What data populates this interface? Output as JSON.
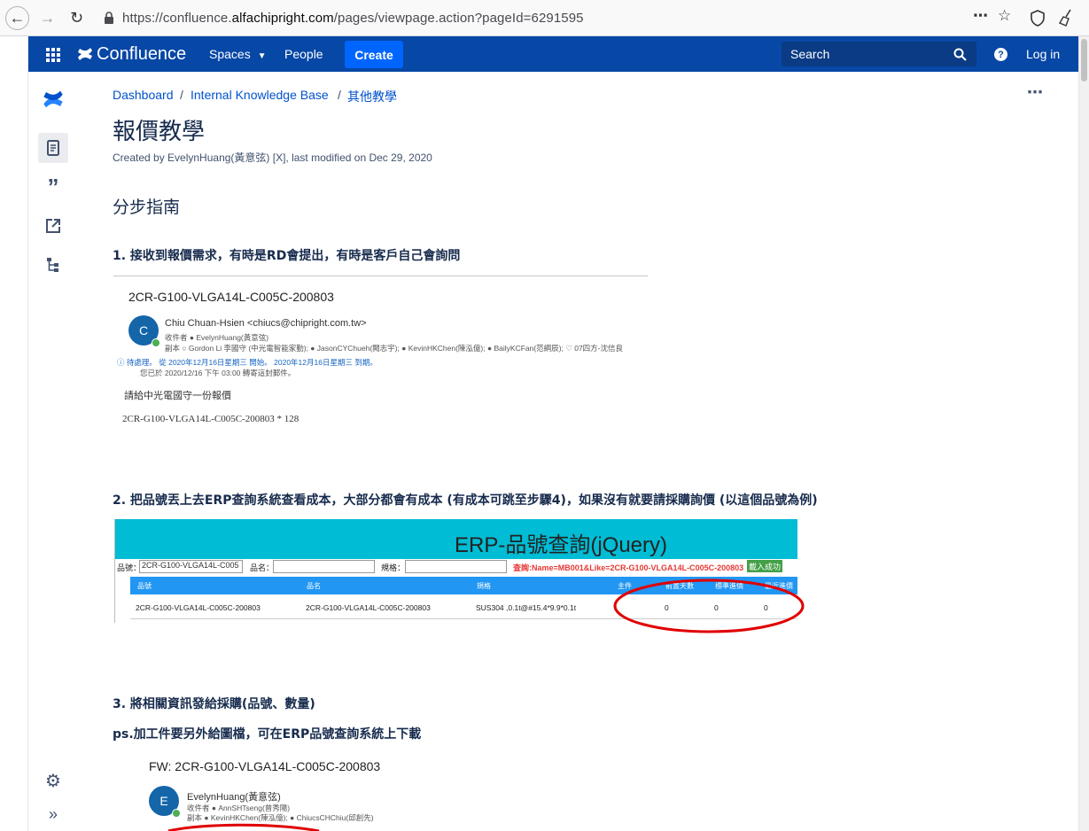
{
  "browser": {
    "url_prefix": "https://confluence.",
    "url_domain": "alfachipright.com",
    "url_suffix": "/pages/viewpage.action?pageId=6291595"
  },
  "header": {
    "logo_text": "Confluence",
    "spaces_label": "Spaces",
    "people_label": "People",
    "create_label": "Create",
    "search_placeholder": "Search",
    "login_label": "Log in"
  },
  "breadcrumbs": [
    "Dashboard",
    "Internal Knowledge Base",
    "其他教學"
  ],
  "page": {
    "title": "報價教學",
    "byline": "Created by EvelynHuang(黃意弦) [X], last modified on Dec 29, 2020",
    "section_heading": "分步指南",
    "step1": "1. 接收到報價需求，有時是RD會提出，有時是客戶自己會詢問",
    "step2": "2. 把品號丟上去ERP查詢系統查看成本，大部分都會有成本 (有成本可跳至步驟4)，如果沒有就要請採購詢價 (以這個品號為例)",
    "step3": "3. 將相關資訊發給採購(品號、數量)",
    "step3_note": "ps.加工件要另外給圖檔，可在ERP品號查詢系統上下載"
  },
  "email1": {
    "subject": "2CR-G100-VLGA14L-C005C-200803",
    "avatar_letter": "C",
    "from": "Chiu Chuan-Hsien <chiucs@chipright.com.tw>",
    "to": "收件者  ● EvelynHuang(黃意弦)",
    "cc": "副本  ○ Gordon Li 李國守 (中光電智能家勤); ● JasonCYChueh(闕志宇); ● KevinHKChen(陳泓億); ● BailyKCFan(范綱辰); ♡ 07四方-沈信良",
    "notice1": "待處理。 從 2020年12月16日星期三 開始。 2020年12月16日星期三 到期。",
    "notice2": "您已於 2020/12/16 下午 03:00 轉寄這封郵件。",
    "body1": "請給中光電國守一份報價",
    "body2": "2CR-G100-VLGA14L-C005C-200803 * 128"
  },
  "erp": {
    "title": "ERP-品號查詢(jQuery)",
    "label_part": "品號：",
    "part_value": "2CR-G100-VLGA14L-C005",
    "label_name": "品名：",
    "label_spec": "規格：",
    "query_text": "查詢:Name=MB001&Like=2CR-G100-VLGA14L-C005C-200803",
    "load_ok": "載入成功",
    "columns": [
      "品號",
      "品名",
      "規格",
      "主件",
      "前置天數",
      "標準進價",
      "最近進價"
    ],
    "row": [
      "2CR-G100-VLGA14L-C005C-200803",
      "2CR-G100-VLGA14L-C005C-200803",
      "SUS304 ,0.1t@#15.4*9.9*0.1t",
      "",
      "0",
      "0",
      "0"
    ]
  },
  "email2": {
    "subject": "FW: 2CR-G100-VLGA14L-C005C-200803",
    "avatar_letter": "E",
    "from": "EvelynHuang(黃意弦)",
    "to": "收件者  ● AnnSHTseng(曾秀陽)",
    "cc": "副本  ● KevinHKChen(陳泓億); ● ChiucsCHChiu(邱創先)"
  },
  "colors": {
    "header_bg": "#0747a6",
    "create_bg": "#0065ff",
    "link": "#0052cc",
    "erp_banner": "#00bcd4",
    "erp_thead": "#2196f3",
    "highlight_ellipse": "#e00000"
  },
  "icons": [
    "back-arrow-icon",
    "forward-arrow-icon",
    "reload-icon",
    "lock-icon",
    "more-dots-icon",
    "star-icon",
    "shield-icon",
    "broom-icon",
    "app-grid-icon",
    "confluence-logo-icon",
    "chevron-down-icon",
    "search-icon",
    "help-icon",
    "page-icon",
    "quote-icon",
    "share-icon",
    "page-tree-icon",
    "settings-icon",
    "expand-icon",
    "ellipsis-icon"
  ]
}
